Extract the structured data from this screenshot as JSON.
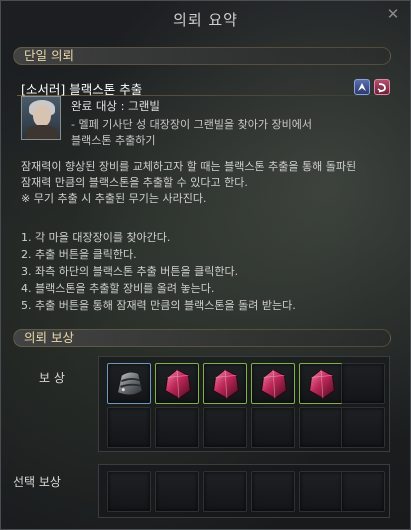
{
  "window": {
    "title": "의뢰 요약",
    "close_glyph": "✕"
  },
  "sections": {
    "single_quest": "단일 의뢰",
    "rewards": "의뢰 보상"
  },
  "quest": {
    "title": "[소서러] 블랙스톤 추출",
    "target": "완료 대상 : 그랜빌",
    "desc_line1": "- 멜페 기사단 성 대장장이 그랜빌을 찾아가 장비에서",
    "desc_line2": "블랙스톤 추출하기",
    "icons": [
      "navigate-icon",
      "cancel-quest-icon"
    ]
  },
  "body": {
    "line1": "잠재력이 향상된 장비를 교체하고자 할 때는 블랙스톤 추출을 통해 돌파된",
    "line2": "잠재력 만큼의 블랙스톤을 추출할 수 있다고 한다.",
    "line3": "※ 무기 추출 시 추출된 무기는 사라진다."
  },
  "steps": [
    "1. 각 마을 대장장이를 찾아간다.",
    "2. 추출 버튼을 클릭한다.",
    "3. 좌측 하단의 블랙스톤 추출 버튼을 클릭한다.",
    "4. 블랙스톤을 추출할 장비를 올려 놓는다.",
    "5. 추출 버튼을 통해 잠재력 만큼의 블랙스톤을 돌려 받는다."
  ],
  "rewards": {
    "basic_label": "보 상",
    "choice_label": "선택 보상",
    "items": [
      "armor-piece-icon",
      "red-crystal-icon",
      "red-crystal-icon",
      "red-crystal-icon",
      "red-crystal-icon"
    ]
  },
  "colors": {
    "accent_gold": "#e8d9a8",
    "crystal": "#c0285a"
  }
}
